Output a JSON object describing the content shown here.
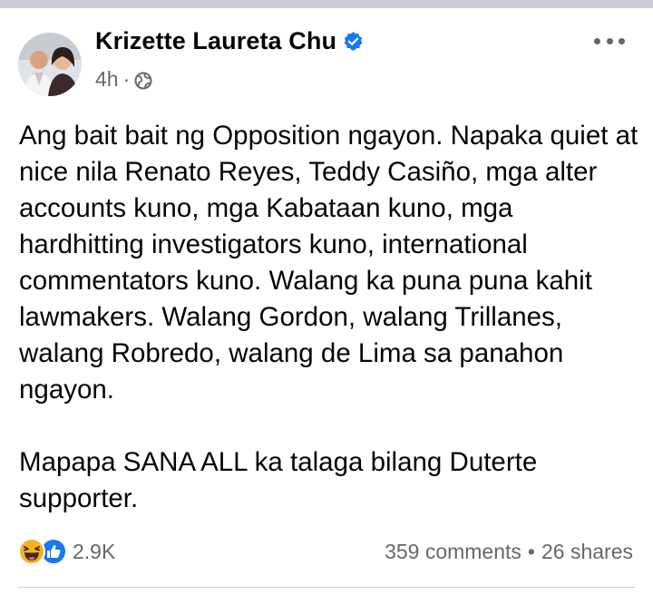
{
  "post": {
    "author": "Krizette Laureta Chu",
    "time": "4h",
    "meta_dot": "·",
    "paragraphs": [
      "Ang bait bait ng Opposition ngayon. Napaka quiet at nice nila Renato Reyes, Teddy Casiño, mga alter accounts kuno, mga Kabataan kuno, mga hardhitting investigators kuno, international commentators kuno. Walang ka puna puna kahit lawmakers. Walang Gordon, walang Trillanes, walang Robredo, walang de Lima sa panahon ngayon.",
      "Mapapa SANA ALL ka talaga bilang Duterte supporter."
    ]
  },
  "footer": {
    "reaction_icons": [
      "haha-emoji-icon",
      "like-thumb-icon"
    ],
    "reaction_count": "2.9K",
    "comments": "359 comments",
    "stat_sep": "•",
    "shares": "26 shares"
  },
  "colors": {
    "verified_blue": "#1877f2",
    "meta_gray": "#65676b",
    "haha_yellow": "#f7b125"
  }
}
